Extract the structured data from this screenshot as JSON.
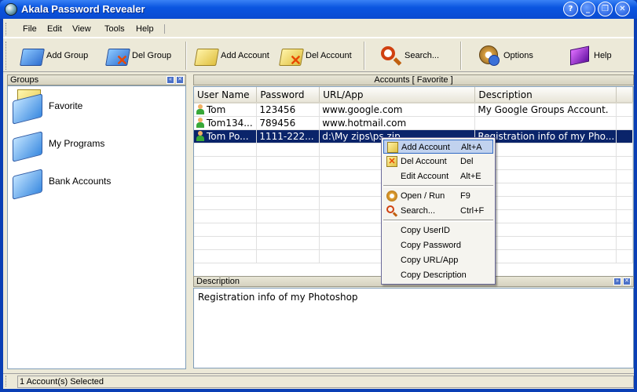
{
  "window": {
    "title": "Akala Password Revealer"
  },
  "menu": [
    "File",
    "Edit",
    "View",
    "Tools",
    "Help"
  ],
  "toolbar": {
    "add_group": "Add Group",
    "del_group": "Del Group",
    "add_account": "Add Account",
    "del_account": "Del Account",
    "search": "Search...",
    "options": "Options",
    "help": "Help"
  },
  "groups": {
    "header": "Groups",
    "items": [
      "Favorite",
      "My Programs",
      "Bank Accounts"
    ]
  },
  "accounts": {
    "header": "Accounts [ Favorite ]",
    "columns": [
      "User Name",
      "Password",
      "URL/App",
      "Description"
    ],
    "rows": [
      [
        "Tom",
        "123456",
        "www.google.com",
        "My Google Groups Account."
      ],
      [
        "Tom134...",
        "789456",
        "www.hotmail.com",
        ""
      ],
      [
        "Tom Po...",
        "1111-222...",
        "d:\\My zips\\ps.zip",
        "Registration info of my Pho..."
      ]
    ],
    "selected_row": 2
  },
  "description": {
    "header": "Description",
    "text": "Registration info of my Photoshop"
  },
  "context_menu": {
    "items": [
      {
        "label": "Add Account",
        "shortcut": "Alt+A"
      },
      {
        "label": "Del Account",
        "shortcut": "Del"
      },
      {
        "label": "Edit Account",
        "shortcut": "Alt+E"
      },
      {
        "label": "Open / Run",
        "shortcut": "F9"
      },
      {
        "label": "Search...",
        "shortcut": "Ctrl+F"
      },
      {
        "label": "Copy UserID",
        "shortcut": ""
      },
      {
        "label": "Copy Password",
        "shortcut": ""
      },
      {
        "label": "Copy URL/App",
        "shortcut": ""
      },
      {
        "label": "Copy Description",
        "shortcut": ""
      }
    ]
  },
  "status": {
    "text": "1 Account(s) Selected"
  },
  "colors": {
    "titlebar": "#0a55e0",
    "selection": "#0a246a",
    "panel": "#ece9d8"
  }
}
